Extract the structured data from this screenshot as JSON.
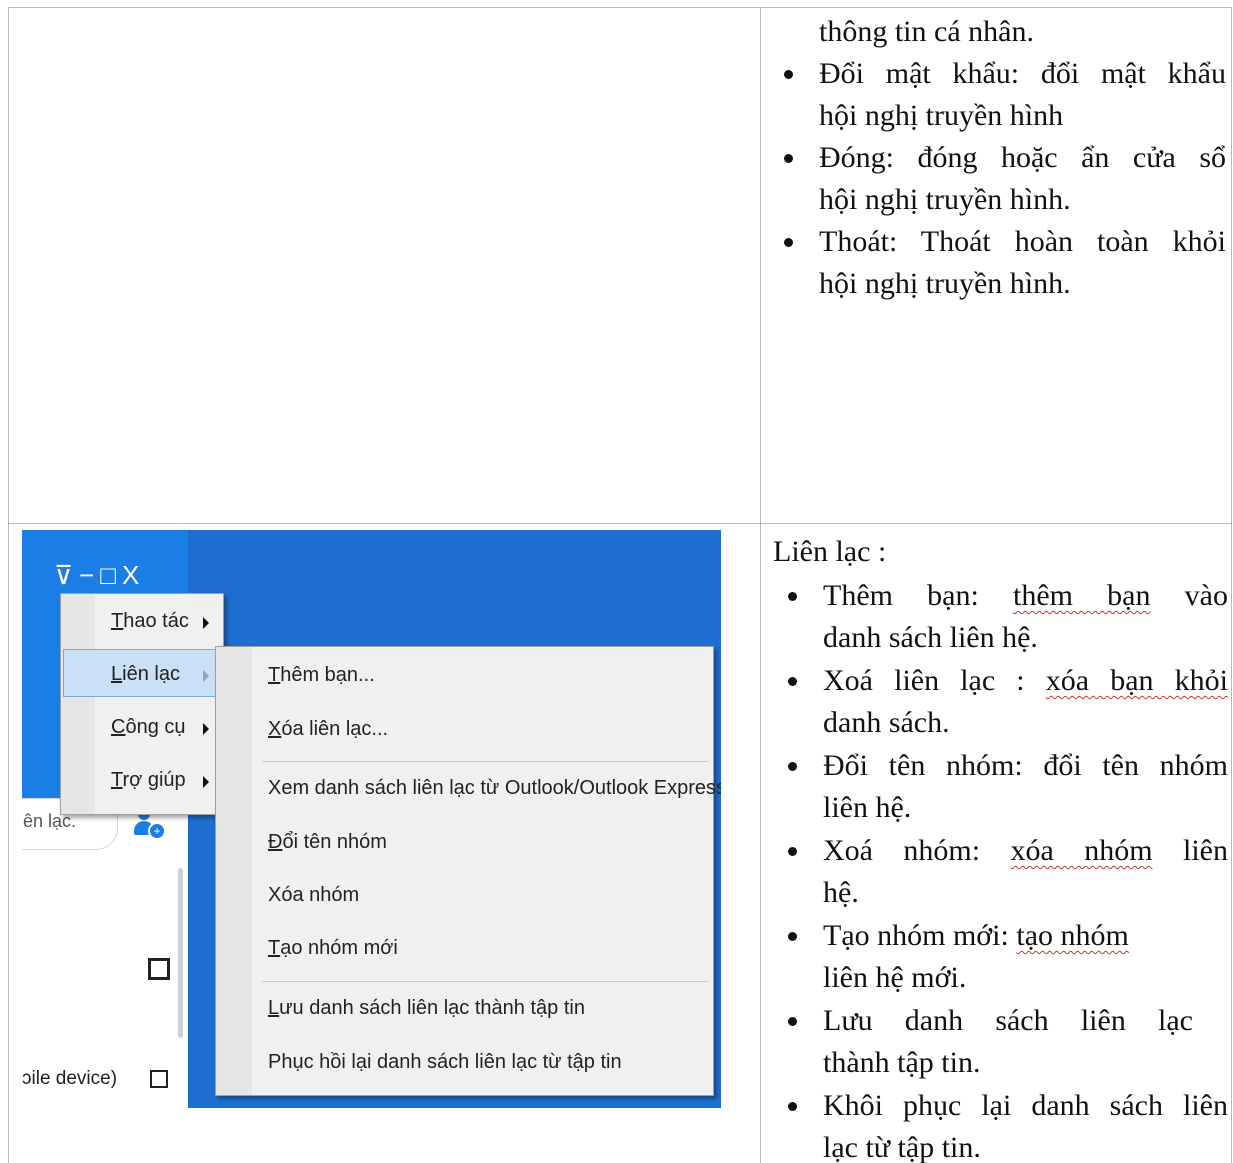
{
  "top_right": {
    "continuation": "thông tin cá nhân.",
    "bullets": [
      {
        "lines": [
          "Đổi mật khẩu: đổi mật khẩu",
          "hội nghị truyền hình"
        ]
      },
      {
        "lines": [
          "Đóng: đóng hoặc ẩn cửa sổ",
          "hội nghị truyền hình."
        ]
      },
      {
        "lines": [
          "Thoát: Thoát hoàn toàn khỏi",
          "hội nghị truyền hình."
        ]
      }
    ]
  },
  "bottom_right": {
    "heading": "Liên lạc :",
    "items": [
      {
        "pre": "Thêm bạn: ",
        "link": "thêm bạn",
        "post": " vào",
        "line2": "danh sách liên hệ."
      },
      {
        "pre": "Xoá liên lạc : ",
        "link": "xóa bạn khỏi",
        "post": "",
        "line2": "danh sách."
      },
      {
        "pre": "Đổi tên nhóm: đổi tên nhóm",
        "link": "",
        "post": "",
        "line2": "liên hệ."
      },
      {
        "pre": "Xoá nhóm: ",
        "link": "xóa nhóm",
        "post": " liên",
        "line2": "hệ."
      },
      {
        "pre": "Tạo nhóm mới: ",
        "link": "tạo nhóm",
        "post": "",
        "line2": "liên hệ mới."
      },
      {
        "pre": "Lưu danh sách liên lạc",
        "link": "",
        "post": "",
        "line2": "thành tập tin."
      },
      {
        "pre": "Khôi phục lại danh sách liên",
        "link": "",
        "post": "",
        "line2": "lạc từ tập tin."
      }
    ]
  },
  "screenshot": {
    "window_controls": [
      "⊽",
      "−",
      "□",
      "X"
    ],
    "search_placeholder": "ên lạc.",
    "device_label": "ɔile device)",
    "main_menu": [
      {
        "accel": "T",
        "rest": "hao tác"
      },
      {
        "accel": "L",
        "rest": "iên lạc"
      },
      {
        "accel": "C",
        "rest": "ông cụ"
      },
      {
        "accel": "T",
        "rest": "rợ giúp"
      }
    ],
    "submenu": [
      {
        "accel": "T",
        "rest": "hêm bạn..."
      },
      {
        "accel": "X",
        "rest": "óa liên lạc..."
      },
      {
        "accel": "",
        "rest": "Xem danh sách liên lạc từ Outlook/Outlook Express"
      },
      {
        "accel": "Đ",
        "rest": "ổi tên nhóm"
      },
      {
        "accel": "",
        "rest": "Xóa nhóm"
      },
      {
        "accel": "T",
        "rest": "ạo nhóm mới"
      },
      {
        "accel": "L",
        "rest": "ưu danh sách liên lạc thành tập tin"
      },
      {
        "accel": "",
        "rest": "Phục hồi lại danh sách liên lạc từ tập tin"
      }
    ]
  }
}
